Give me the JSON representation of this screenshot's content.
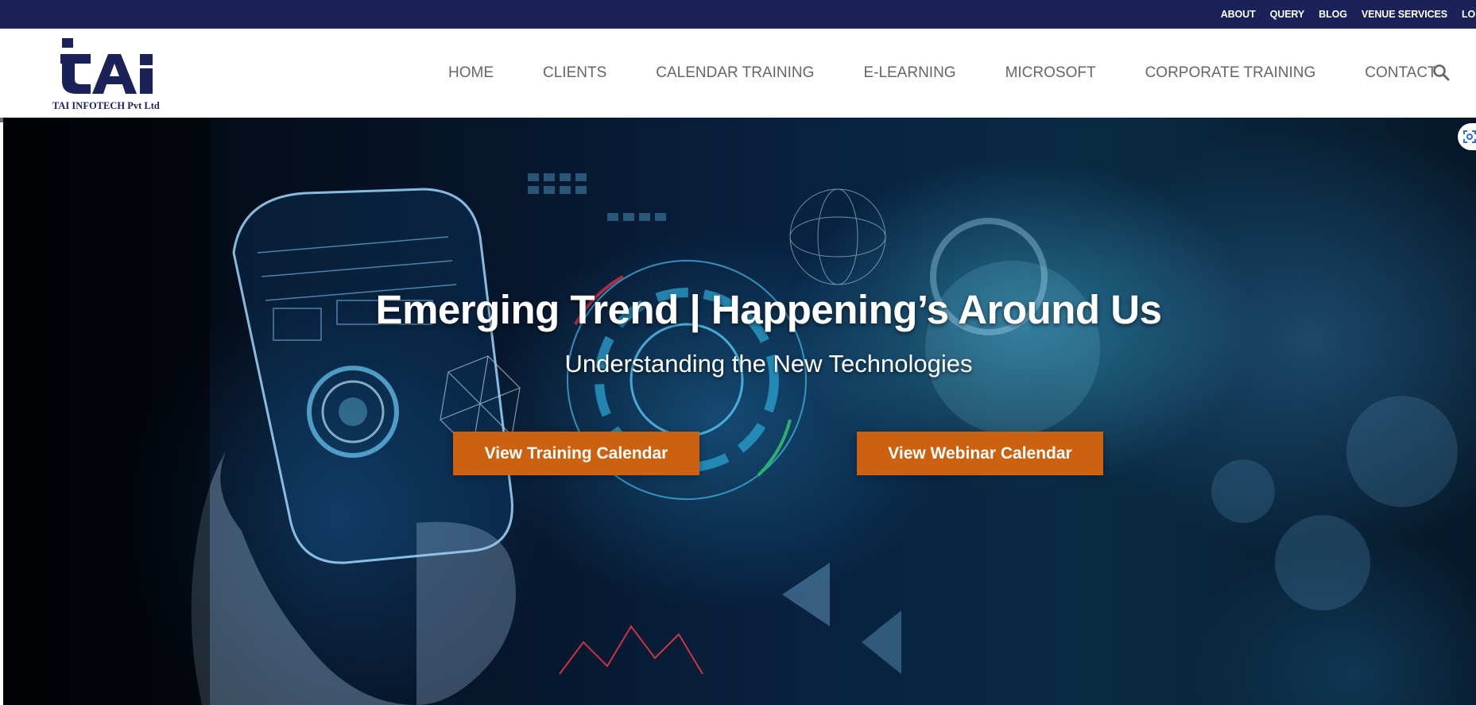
{
  "topbar": {
    "links": [
      "ABOUT",
      "QUERY",
      "BLOG",
      "VENUE SERVICES",
      "LO"
    ]
  },
  "header": {
    "logo_mark": "tAi",
    "logo_text": "TAI INFOTECH Pvt Ltd",
    "nav": [
      "HOME",
      "CLIENTS",
      "CALENDAR TRAINING",
      "E-LEARNING",
      "MICROSOFT",
      "CORPORATE TRAINING",
      "CONTACT"
    ],
    "search_icon": "search-icon"
  },
  "hero": {
    "title": "Emerging Trend | Happening’s Around Us",
    "subtitle": "Understanding the New Technologies",
    "buttons": {
      "training": "View Training Calendar",
      "webinar": "View Webinar Calendar"
    },
    "button_color": "#cc620f"
  },
  "colors": {
    "topbar": "#1b2259",
    "brand": "#1b2259",
    "nav_text": "#666666"
  }
}
